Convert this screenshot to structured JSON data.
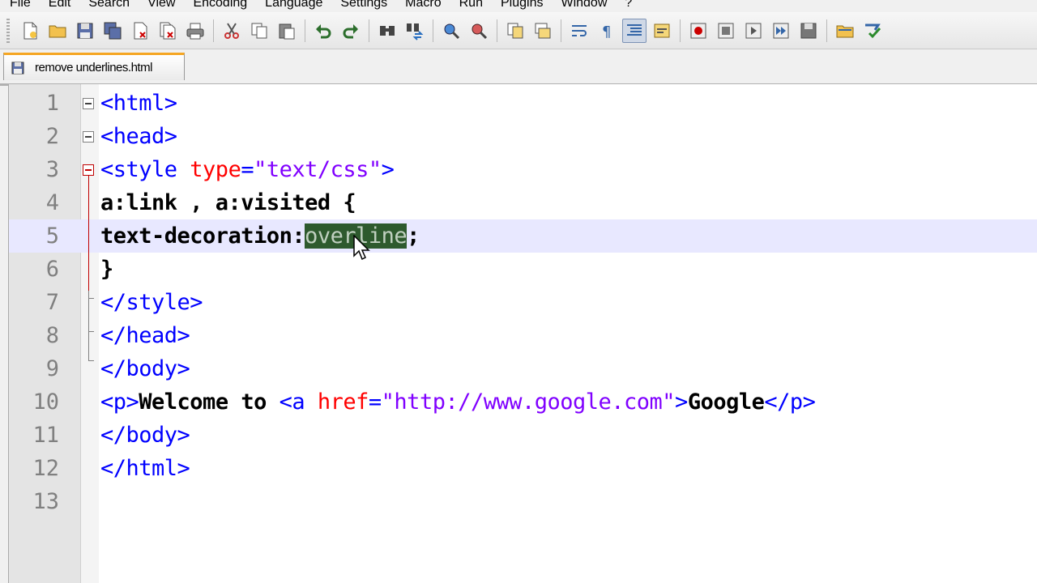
{
  "menu": [
    "File",
    "Edit",
    "Search",
    "View",
    "Encoding",
    "Language",
    "Settings",
    "Macro",
    "Run",
    "Plugins",
    "Window",
    "?"
  ],
  "tab": {
    "label": "remove underlines.html"
  },
  "editor": {
    "lines": [
      {
        "num": "1"
      },
      {
        "num": "2"
      },
      {
        "num": "3"
      },
      {
        "num": "4"
      },
      {
        "num": "5"
      },
      {
        "num": "6"
      },
      {
        "num": "7"
      },
      {
        "num": "8"
      },
      {
        "num": "9"
      },
      {
        "num": "10"
      },
      {
        "num": "11"
      },
      {
        "num": "12"
      },
      {
        "num": "13"
      }
    ],
    "code": {
      "l1": "<html>",
      "l2": "<head>",
      "l3_open": "<style ",
      "l3_attr": "type",
      "l3_eq": "=",
      "l3_val": "\"text/css\"",
      "l3_close": ">",
      "l4": "a:link , a:visited {",
      "l5_prop": "text-decoration:",
      "l5_sel": "overline",
      "l5_end": ";",
      "l6": "}",
      "l7": "</style>",
      "l8": "</head>",
      "l9": "</body>",
      "l10_p": "<p>",
      "l10_text": "Welcome to ",
      "l10_a": "<a ",
      "l10_attr": "href",
      "l10_eq": "=",
      "l10_val": "\"http://www.google.com\"",
      "l10_gt": ">",
      "l10_link": "Google",
      "l10_pclose": "</p>",
      "l11": "</body>",
      "l12": "</html>"
    },
    "current_line": 5
  },
  "colors": {
    "tag": "#0000ff",
    "attribute": "#ff0000",
    "string": "#8000ff",
    "selection": "#2e5a2e",
    "tab_accent": "#f5a623"
  },
  "toolbar_icons": [
    "new-file-icon",
    "open-folder-icon",
    "save-icon",
    "save-all-icon",
    "close-icon",
    "close-all-icon",
    "print-icon",
    "cut-icon",
    "copy-icon",
    "paste-icon",
    "undo-icon",
    "redo-icon",
    "find-icon",
    "replace-icon",
    "zoom-in-icon",
    "zoom-out-icon",
    "sync-vertical-icon",
    "sync-horizontal-icon",
    "word-wrap-icon",
    "show-all-chars-icon",
    "indent-guide-icon",
    "user-lang-icon",
    "record-macro-icon",
    "stop-record-icon",
    "play-macro-icon",
    "play-multiple-icon",
    "save-macro-icon",
    "folder-icon",
    "spellcheck-icon"
  ]
}
